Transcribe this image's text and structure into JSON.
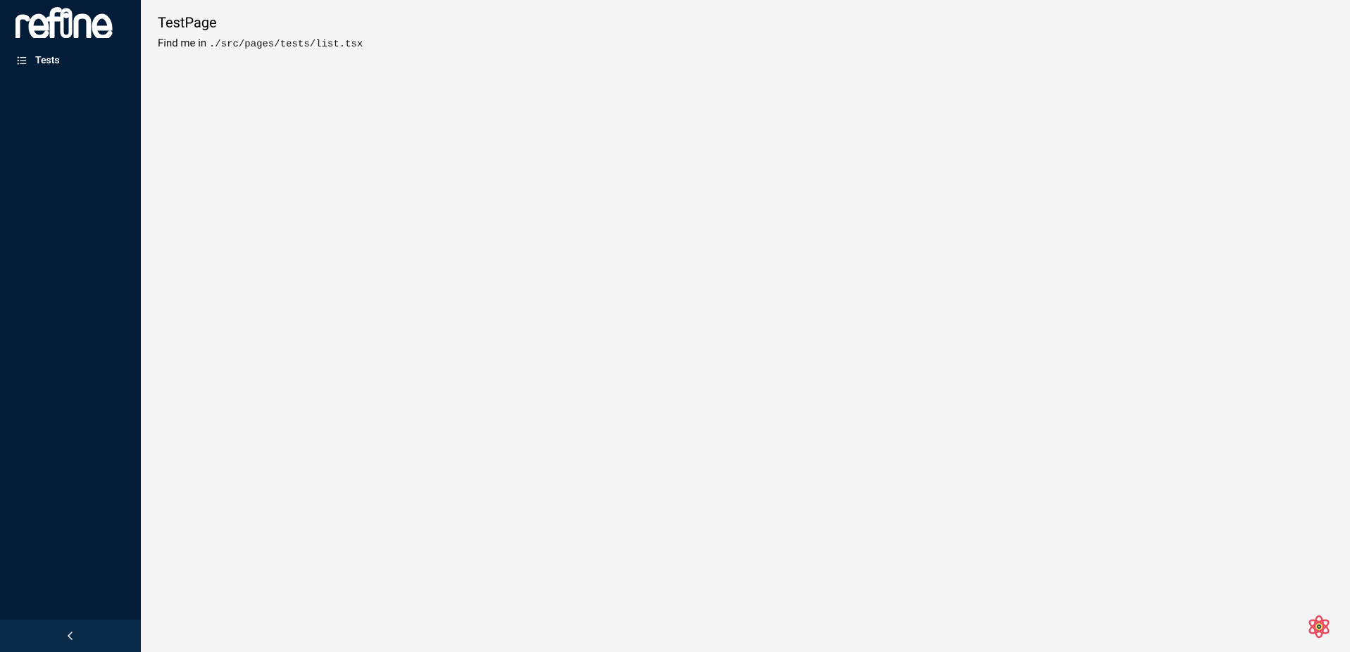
{
  "logo": {
    "text": "refine"
  },
  "sidebar": {
    "items": [
      {
        "label": "Tests"
      }
    ]
  },
  "main": {
    "title": "TestPage",
    "subtitle_prefix": "Find me in ",
    "subtitle_code": "./src/pages/tests/list.tsx"
  }
}
